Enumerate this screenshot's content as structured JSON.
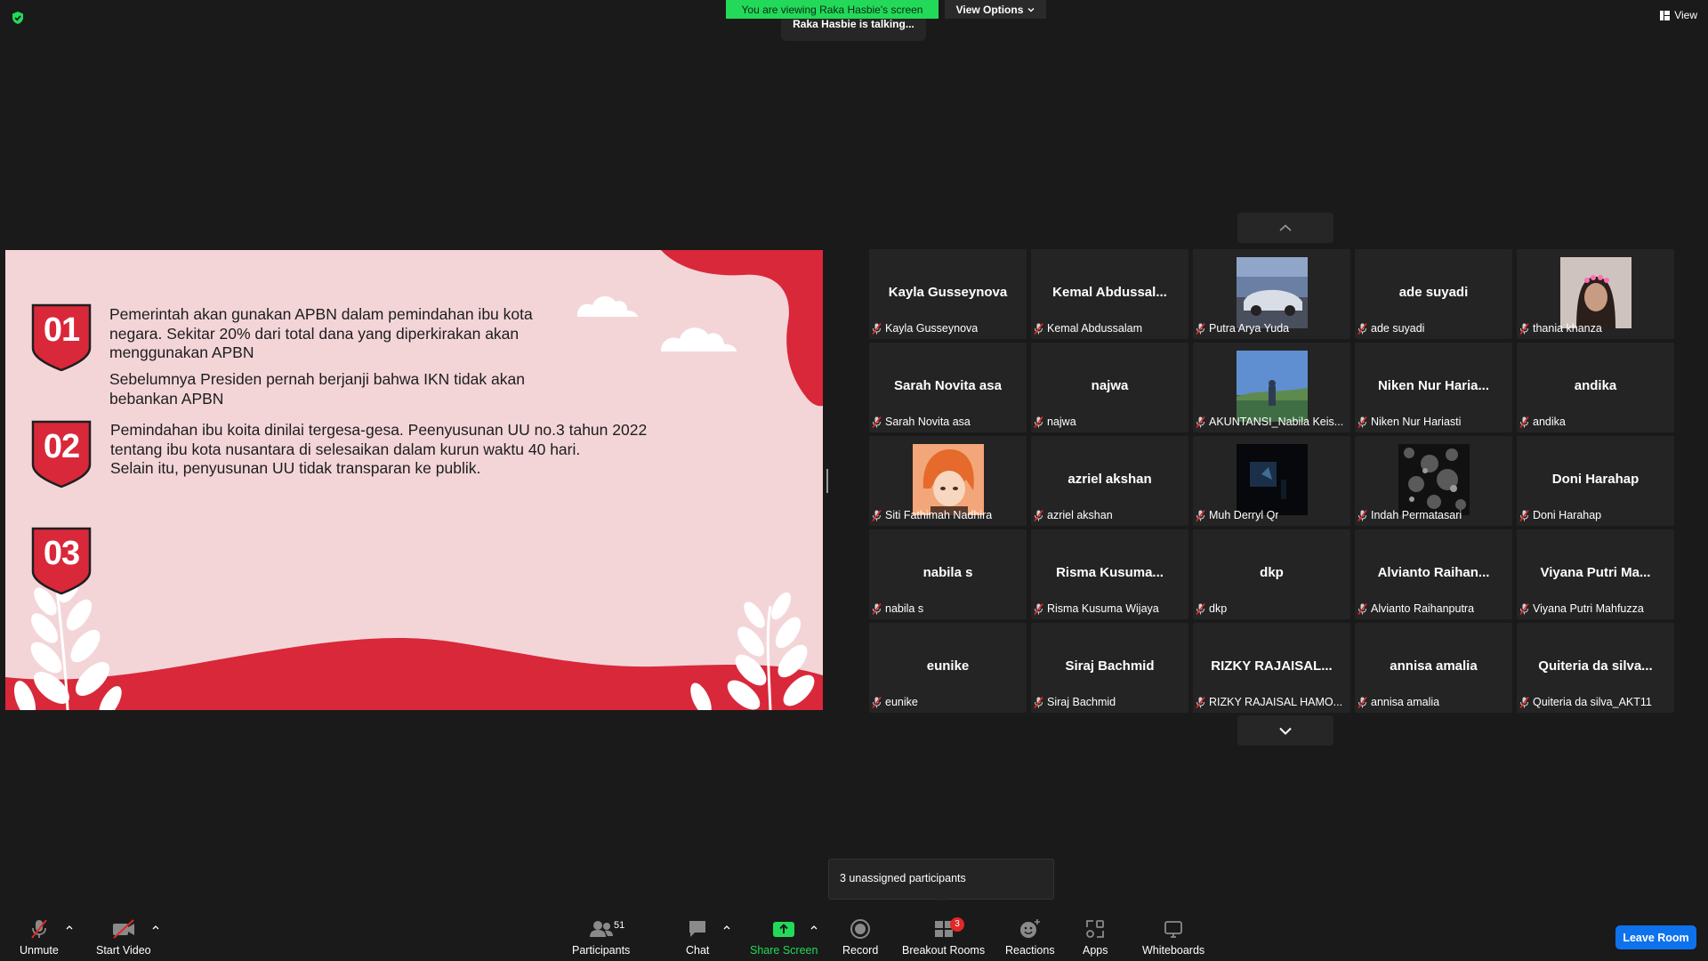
{
  "top": {
    "banner": "You are viewing Raka Hasbie's screen",
    "view_options": "View Options",
    "talking": "Raka Hasbie is talking...",
    "view": "View"
  },
  "slide": {
    "badge1": "01",
    "badge2": "02",
    "badge3": "03",
    "p1_line1": "Pemerintah akan gunakan APBN dalam pemindahan ibu kota",
    "p1_line2": "negara. Sekitar 20% dari total dana yang diperkirakan akan",
    "p1_line3": "menggunakan APBN",
    "p2_line1": "Sebelumnya Presiden pernah berjanji bahwa IKN tidak akan",
    "p2_line2": "bebankan APBN",
    "p3_line1": "Pemindahan ibu koita dinilai tergesa-gesa. Peenyusunan UU no.3 tahun 2022",
    "p3_line2": "tentang ibu kota nusantara di selesaikan dalam kurun waktu 40 hari.",
    "p3_line3": "Selain itu, penyusunan UU tidak transparan ke publik."
  },
  "participants": [
    {
      "big": "Kayla Gusseynova",
      "name": "Kayla Gusseynova"
    },
    {
      "big": "Kemal  Abdussal...",
      "name": "Kemal Abdussalam"
    },
    {
      "big": "",
      "name": "Putra Arya Yuda",
      "photo": "car"
    },
    {
      "big": "ade suyadi",
      "name": "ade suyadi"
    },
    {
      "big": "",
      "name": "thania khanza",
      "photo": "girl"
    },
    {
      "big": "Sarah Novita asa",
      "name": "Sarah Novita asa"
    },
    {
      "big": "najwa",
      "name": "najwa"
    },
    {
      "big": "",
      "name": "AKUNTANSI_Nabila Keis...",
      "photo": "landscape"
    },
    {
      "big": "Niken  Nur  Haria...",
      "name": "Niken Nur Hariasti"
    },
    {
      "big": "andika",
      "name": "andika"
    },
    {
      "big": "",
      "name": "Siti Fathimah Nadhira",
      "photo": "anime"
    },
    {
      "big": "azriel akshan",
      "name": "azriel akshan"
    },
    {
      "big": "",
      "name": "Muh Derryl Qr",
      "photo": "dark"
    },
    {
      "big": "",
      "name": "Indah Permatasari",
      "photo": "bw"
    },
    {
      "big": "Doni Harahap",
      "name": "Doni Harahap"
    },
    {
      "big": "nabila s",
      "name": "nabila s"
    },
    {
      "big": "Risma  Kusuma...",
      "name": "Risma Kusuma Wijaya"
    },
    {
      "big": "dkp",
      "name": "dkp"
    },
    {
      "big": "Alvianto  Raihan...",
      "name": "Alvianto Raihanputra"
    },
    {
      "big": "Viyana Putri Ma...",
      "name": "Viyana Putri Mahfuzza"
    },
    {
      "big": "eunike",
      "name": "eunike"
    },
    {
      "big": "Siraj Bachmid",
      "name": "Siraj Bachmid"
    },
    {
      "big": "RIZKY RAJAISAL...",
      "name": "RIZKY RAJAISAL HAMO..."
    },
    {
      "big": "annisa amalia",
      "name": "annisa amalia"
    },
    {
      "big": "Quiteria  da  silva...",
      "name": "Quiteria da silva_AKT11"
    }
  ],
  "tooltip": "3 unassigned participants",
  "toolbar": {
    "unmute": "Unmute",
    "start_video": "Start Video",
    "participants": "Participants",
    "participants_count": "51",
    "chat": "Chat",
    "share_screen": "Share Screen",
    "record": "Record",
    "breakout_rooms": "Breakout Rooms",
    "breakout_badge": "3",
    "reactions": "Reactions",
    "apps": "Apps",
    "whiteboards": "Whiteboards",
    "leave": "Leave Room"
  },
  "colors": {
    "accent_green": "#23d959",
    "slide_red": "#d9283a",
    "slide_pink": "#f3d5d8",
    "leave_blue": "#0e72ed"
  }
}
